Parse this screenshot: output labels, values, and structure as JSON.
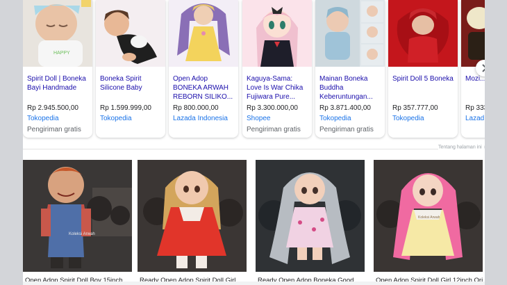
{
  "shopping": {
    "products": [
      {
        "title": "Spirit Doll | Boneka Bayi Handmade",
        "price": "Rp 2.945.500,00",
        "store": "Tokopedia",
        "shipping": "Pengiriman gratis",
        "image": "sleeping-baby-doll"
      },
      {
        "title": "Boneka Spirit Silicone Baby",
        "price": "Rp 1.599.999,00",
        "store": "Tokopedia",
        "shipping": "",
        "image": "baby-doll-in-costume"
      },
      {
        "title": "Open Adop BONEKA ARWAH REBORN SILIKO...",
        "price": "Rp 800.000,00",
        "store": "Lazada Indonesia",
        "shipping": "",
        "image": "blonde-doll-yellow-dress"
      },
      {
        "title": "Kaguya-Sama: Love Is War Chika Fujiwara Pure...",
        "price": "Rp 3.300.000,00",
        "store": "Shopee",
        "shipping": "Pengiriman gratis",
        "image": "anime-figure-doll"
      },
      {
        "title": "Mainan Boneka Buddha Keberuntungan...",
        "price": "Rp 3.871.400,00",
        "store": "Tokopedia",
        "shipping": "Pengiriman gratis",
        "image": "baby-doll-collage"
      },
      {
        "title": "Spirit Doll 5 Boneka",
        "price": "Rp 357.777,00",
        "store": "Tokopedia",
        "shipping": "",
        "image": "doll-red-fur"
      },
      {
        "title": "Mozi...",
        "price": "Rp 333...",
        "store": "Lazad...",
        "shipping": "",
        "image": "porcelain-doll"
      }
    ],
    "next_button": "chevron-right-icon"
  },
  "about_label": "Tentang halaman ini",
  "images": [
    {
      "caption": "Open Adop Spirit Doll Boy 15inch",
      "image": "chucky-doll"
    },
    {
      "caption": "Ready Open Adop Spirit Doll Girl",
      "image": "blonde-doll-red-dress"
    },
    {
      "caption": "Ready Open Adop Boneka Good",
      "image": "gray-hair-doll"
    },
    {
      "caption": "Open Adop Spirit Doll Girl 12inch Ori",
      "image": "pink-hair-doll"
    }
  ],
  "colors": {
    "link": "#1a0dab",
    "store": "#1a73e8",
    "price": "#202124",
    "muted": "#5f6368",
    "page_bg": "#d3d5d9"
  }
}
